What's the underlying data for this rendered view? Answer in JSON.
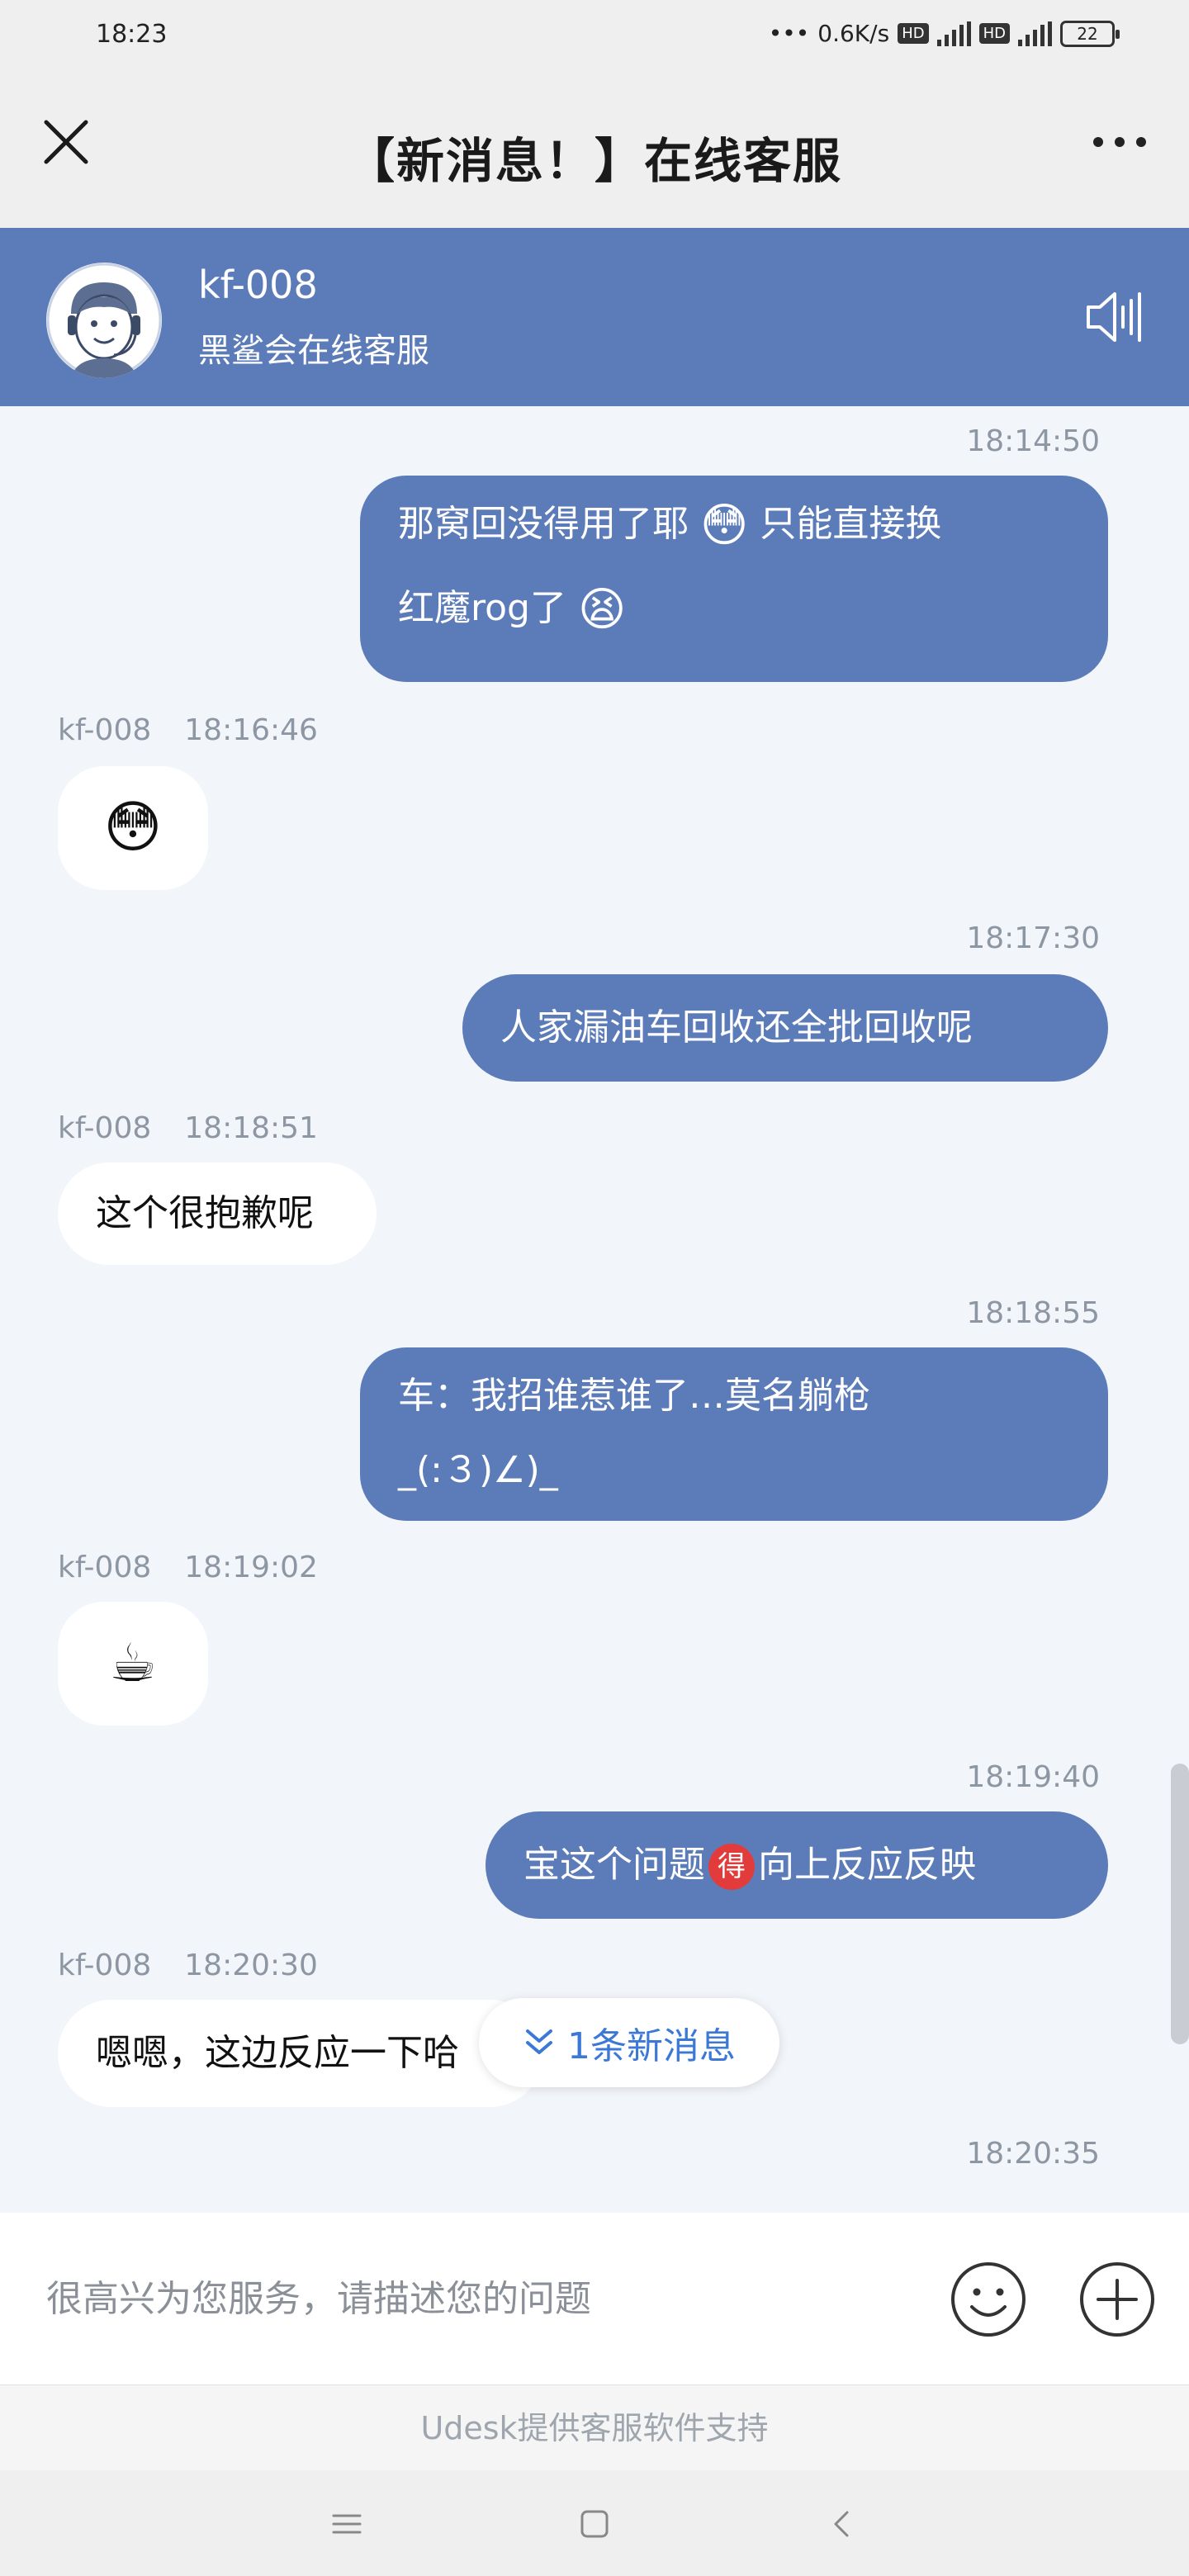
{
  "status_bar": {
    "time": "18:23",
    "dots": "•••",
    "speed": "0.6K/s",
    "hd1": "HD",
    "hd2": "HD",
    "battery": "22"
  },
  "nav": {
    "title": "【新消息！】在线客服",
    "close_icon": "close-icon",
    "more_icon": "more-horizontal-icon"
  },
  "agent": {
    "name": "kf-008",
    "description": "黑鲨会在线客服",
    "sound_icon": "speaker-icon"
  },
  "messages": [
    {
      "side": "mine",
      "time": "18:14:50",
      "line1": "那窝回没得用了耶",
      "emoji1": "😳",
      "line1b": "只能直接换",
      "line2": "红魔rog了",
      "emoji2": "😫"
    },
    {
      "side": "theirs",
      "sender": "kf-008",
      "time": "18:16:46",
      "emoji": "😳"
    },
    {
      "side": "mine",
      "time": "18:17:30",
      "text": "人家漏油车回收还全批回收呢"
    },
    {
      "side": "theirs",
      "sender": "kf-008",
      "time": "18:18:51",
      "text": "这个很抱歉呢"
    },
    {
      "side": "mine",
      "time": "18:18:55",
      "line1": "车：我招谁惹谁了…莫名躺枪",
      "line2": "_(:３)∠)_"
    },
    {
      "side": "theirs",
      "sender": "kf-008",
      "time": "18:19:02",
      "emoji": "☕"
    },
    {
      "side": "mine",
      "time": "18:19:40",
      "text_a": "宝这个问题",
      "badge": "得",
      "text_b": "向上反应反映"
    },
    {
      "side": "theirs",
      "sender": "kf-008",
      "time": "18:20:30",
      "text": "嗯嗯，这边反应一下哈"
    },
    {
      "side": "mine",
      "time": "18:20:35"
    }
  ],
  "new_message_pill": "1条新消息",
  "input": {
    "placeholder": "很高兴为您服务，请描述您的问题",
    "value": ""
  },
  "footer": "Udesk提供客服软件支持",
  "colors": {
    "accent": "#5c7cb9",
    "link": "#3c78d8",
    "background": "#f2f5fa"
  }
}
